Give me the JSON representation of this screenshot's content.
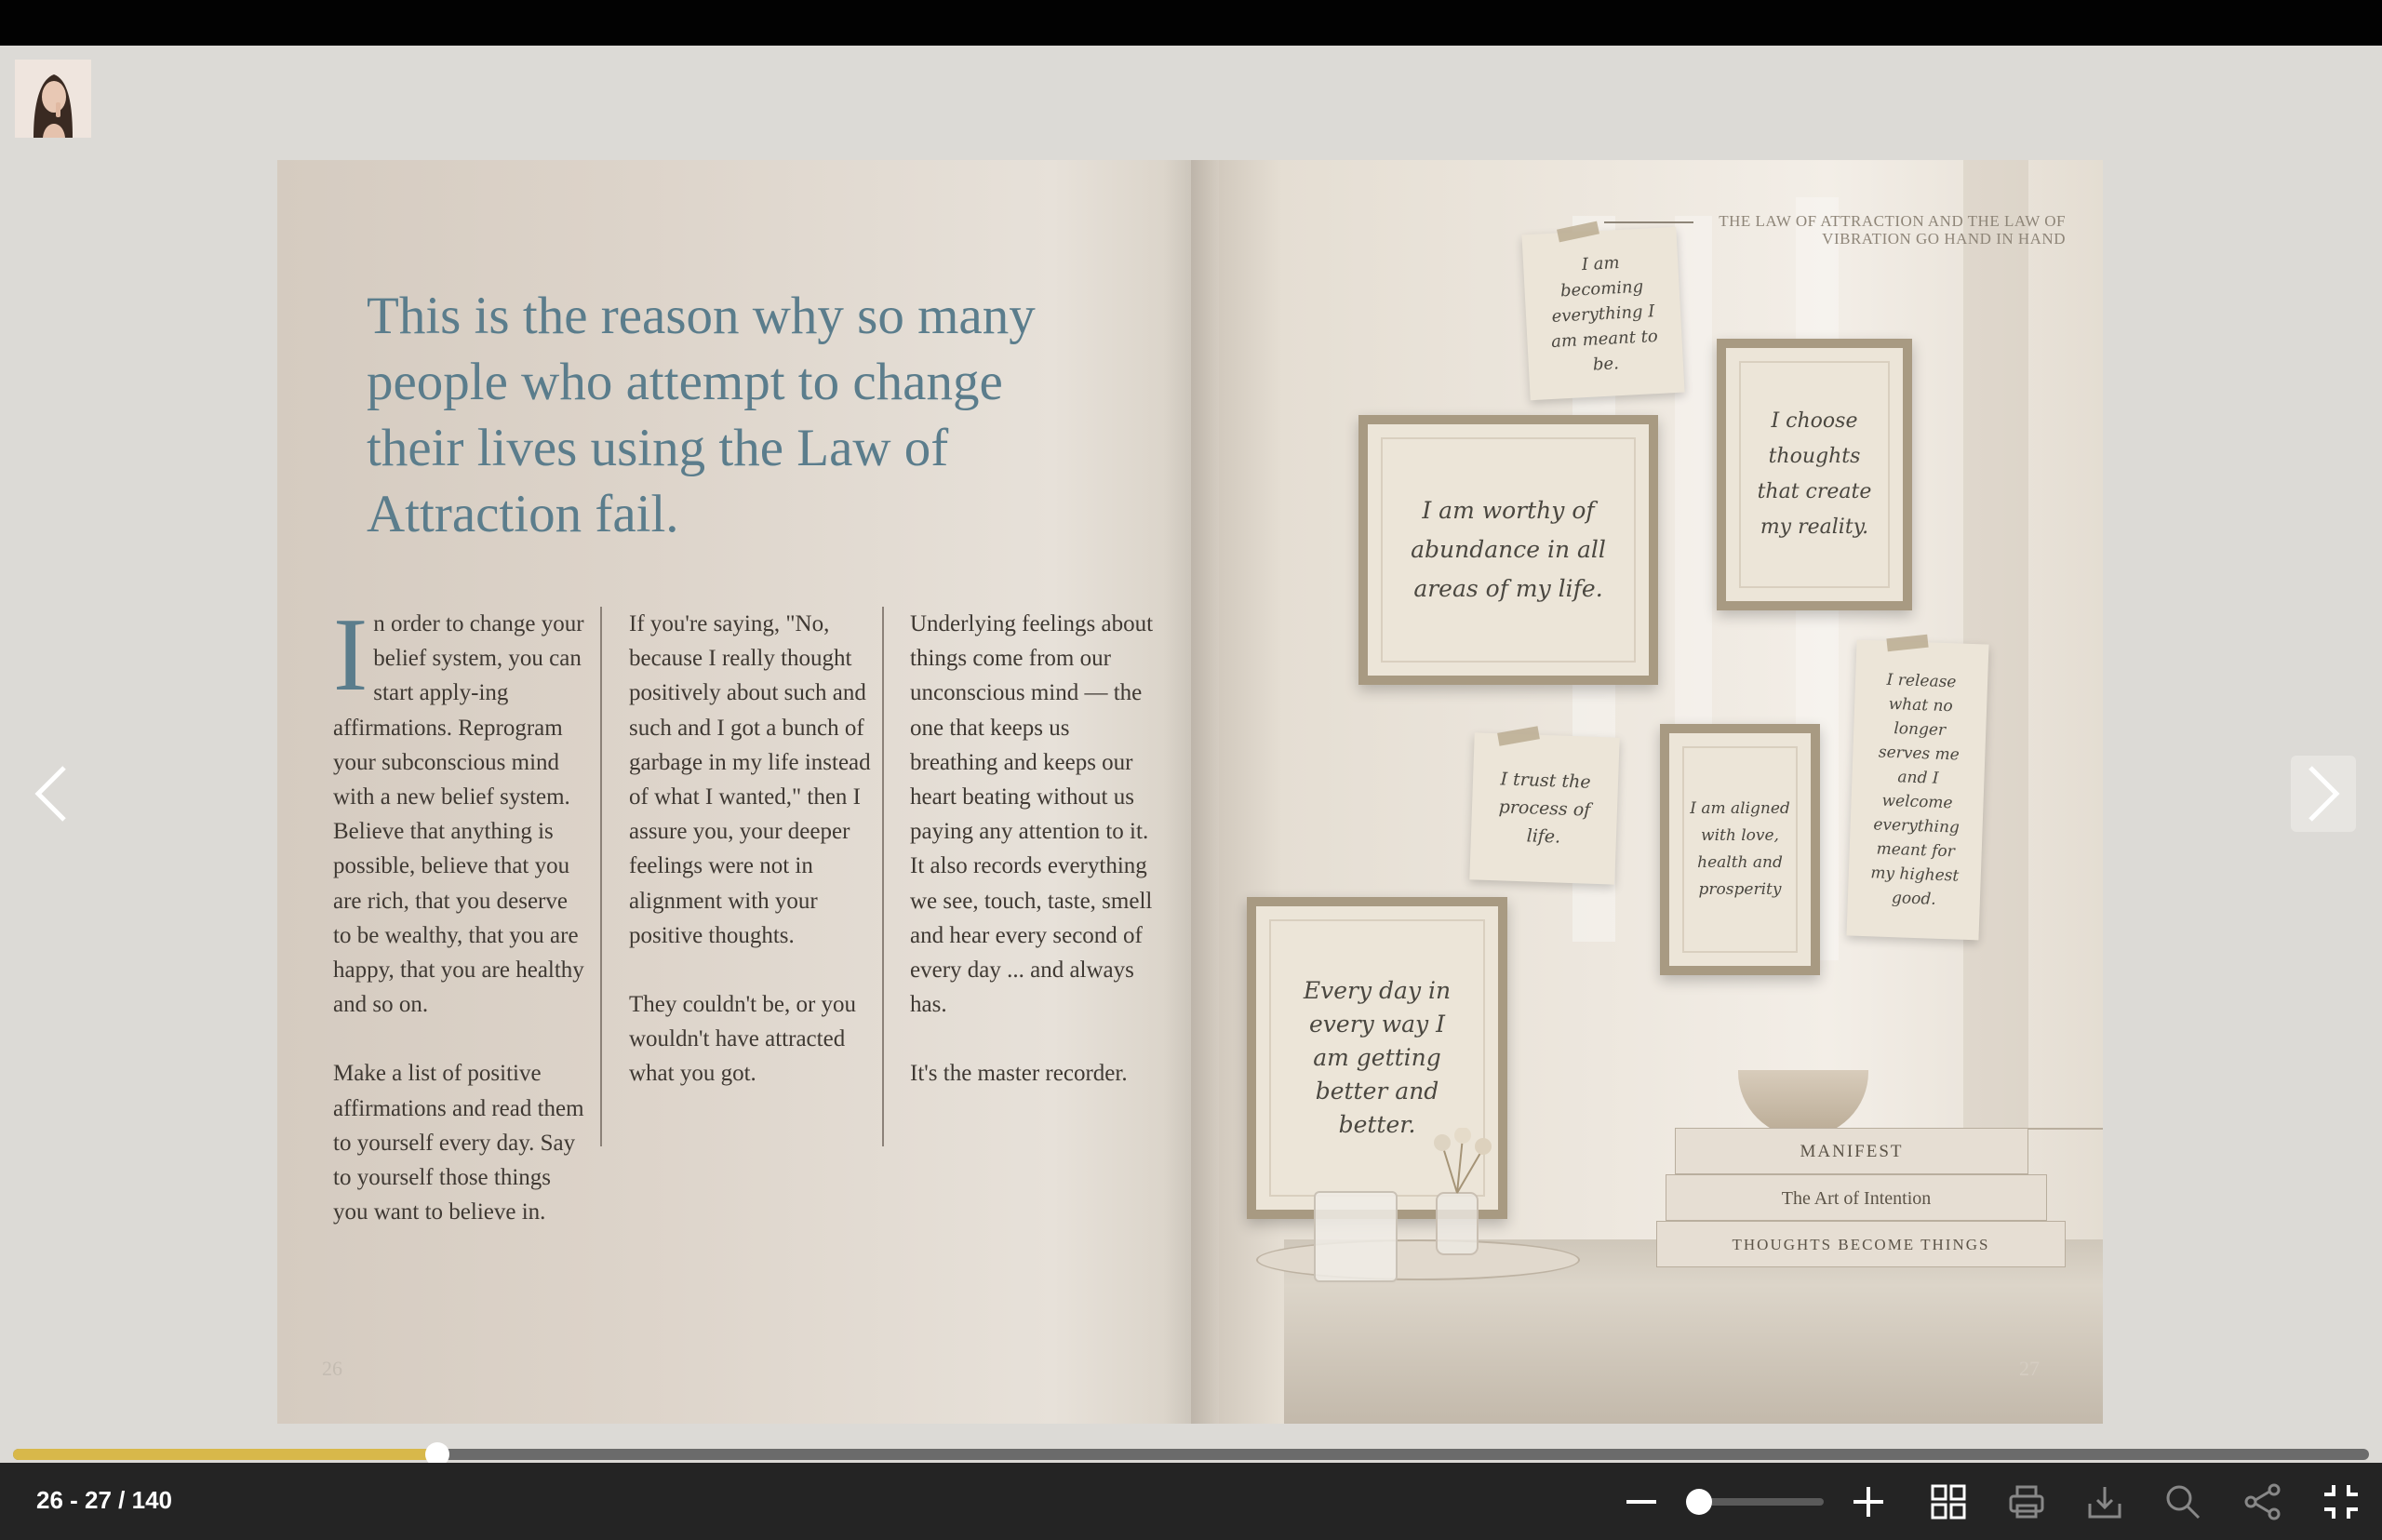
{
  "viewer": {
    "page_indicator": "26 - 27 / 140",
    "progress_fraction": 0.18,
    "zoom_fraction": 0.0
  },
  "left_page": {
    "heading": "This is the reason why so many people who attempt to change their lives using the Law of Attraction fail.",
    "col1_dropcap": "I",
    "col1_p1": "n order to change your belief system, you can start apply-ing affirmations. Reprogram your subconscious mind with a new belief system. Believe that anything is possible, believe that you are rich, that you deserve to be wealthy, that you are happy, that you are healthy and so on.",
    "col1_p2": "Make a list of positive affirmations and read them to yourself every day. Say to yourself those things you want to believe in.",
    "col2_p1": "If you're saying, \"No, because I really thought positively about such and such and I got a bunch of garbage in my life instead of what I wanted,\" then I assure you, your deeper feelings were not in alignment with your positive thoughts.",
    "col2_p2": "They couldn't be, or you wouldn't have attracted what you got.",
    "col3_p1": "Underlying feelings about things come from our unconscious mind — the one that keeps us breathing and keeps our heart beating without us paying any attention to it. It also records everything we see, touch, taste, smell and hear every second of every day ... and always has.",
    "col3_p2": "It's the master recorder.",
    "folio": "26"
  },
  "right_page": {
    "running_head": "THE LAW OF ATTRACTION AND THE LAW OF VIBRATION GO HAND IN HAND",
    "folio": "27",
    "affirmations": {
      "becoming": "I am becoming everything I am meant to be.",
      "choose": "I choose thoughts that create my reality.",
      "worthy": "I am worthy of abundance in all areas of my life.",
      "release": "I release what no longer serves me and I welcome everything meant for my highest good.",
      "trust": "I trust the process of life.",
      "aligned": "I am aligned with love, health and prosperity",
      "everyday": "Every day in every way I am getting better and better."
    },
    "books": [
      "MANIFEST",
      "The Art of Intention",
      "THOUGHTS BECOME THINGS"
    ]
  },
  "colors": {
    "accent_blue": "#5b7d8c",
    "progress_gold": "#d8b84a",
    "toolbar_bg": "#242424"
  },
  "icons": {
    "prev": "chevron-left-icon",
    "next": "chevron-right-icon",
    "zoom_out": "minus-icon",
    "zoom_in": "plus-icon",
    "thumbnails": "grid-icon",
    "print": "printer-icon",
    "download": "download-icon",
    "search": "search-icon",
    "share": "share-icon",
    "exit_fullscreen": "exit-fullscreen-icon"
  }
}
